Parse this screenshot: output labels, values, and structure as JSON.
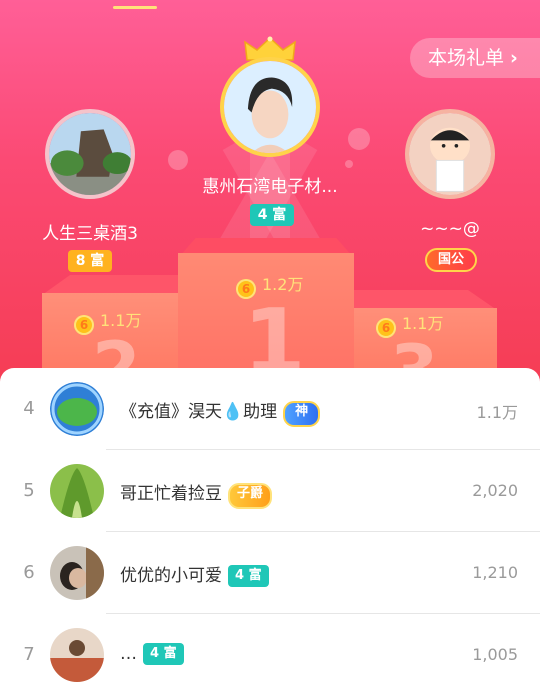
{
  "header": {
    "gift_list_label": "本场礼单",
    "gift_list_chevron": "›"
  },
  "top3": [
    {
      "rank": "1",
      "name": "惠州石湾电子材...",
      "level_badge": "4 富",
      "score": "1.2万"
    },
    {
      "rank": "2",
      "name": "人生三桌酒3",
      "level_badge": "8 富",
      "score": "1.1万"
    },
    {
      "rank": "3",
      "name": "~~~@",
      "level_badge": "国公",
      "score": "1.1万"
    }
  ],
  "coin_glyph": "6",
  "list": [
    {
      "rank": "4",
      "name": "《充值》淏天💧助理",
      "badge": "神",
      "score": "1.1万"
    },
    {
      "rank": "5",
      "name": "哥正忙着捡豆",
      "badge": "子爵",
      "score": "2,020"
    },
    {
      "rank": "6",
      "name": "优优的小可爱",
      "badge": "4 富",
      "score": "1,210"
    },
    {
      "rank": "7",
      "name": "…",
      "badge": "4 富",
      "score": "1,005"
    }
  ],
  "colors": {
    "hero_top": "#ff5f97",
    "hero_bottom": "#f53c52",
    "teal_badge": "#1fc7b7",
    "orange_badge": "#ffb21f",
    "coin": "#ffc21a"
  }
}
